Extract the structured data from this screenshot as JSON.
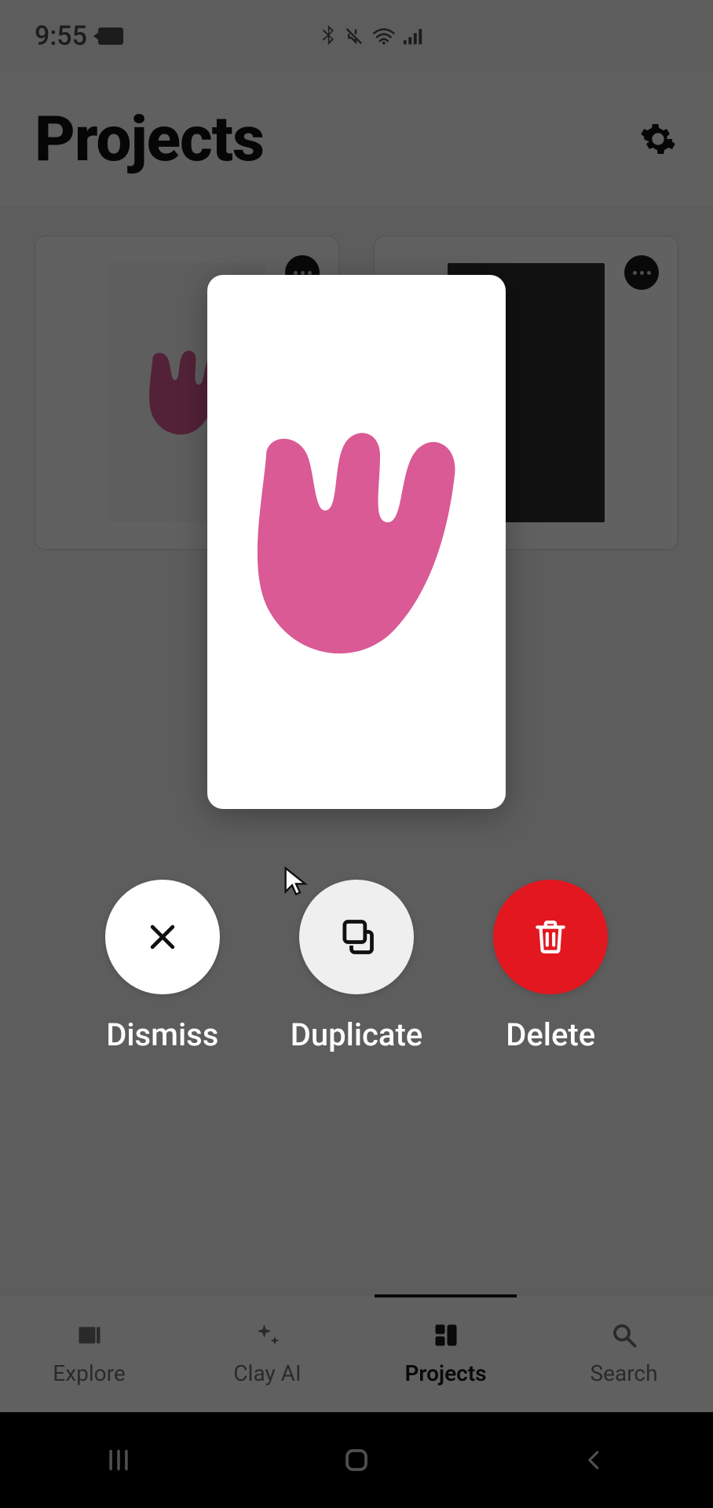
{
  "status": {
    "time": "9:55"
  },
  "header": {
    "title": "Projects"
  },
  "tabs": {
    "explore": "Explore",
    "clayai": "Clay AI",
    "projects": "Projects",
    "search": "Search",
    "active": "projects"
  },
  "modal": {
    "actions": {
      "dismiss": "Dismiss",
      "duplicate": "Duplicate",
      "delete": "Delete"
    }
  },
  "colors": {
    "accent_pink": "#d95a94",
    "delete_red": "#e3171f"
  }
}
